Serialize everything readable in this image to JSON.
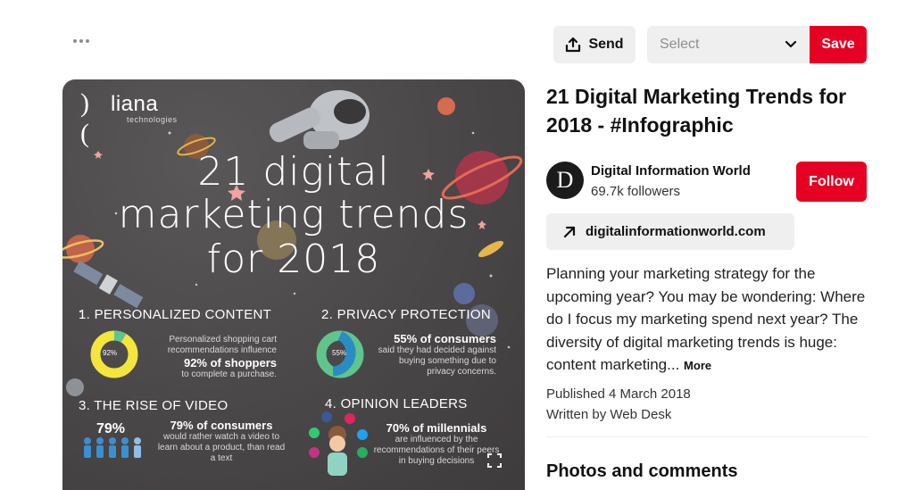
{
  "toolbar": {
    "send_label": "Send",
    "select_value": "Select",
    "save_label": "Save"
  },
  "pin": {
    "title": "21 Digital Marketing Trends for 2018 - #Infographic",
    "author": {
      "name": "Digital Information World",
      "followers": "69.7k followers",
      "avatar_letter": "D"
    },
    "follow_label": "Follow",
    "link_label": "digitalinformationworld.com",
    "description": "Planning your marketing strategy for the upcoming year? You may be wondering: Where do I focus my marketing spend next year? The diversity of digital marketing trends is huge: content marketing...",
    "more_label": "More",
    "published": "Published 4 March 2018",
    "written_by": "Written by Web Desk",
    "photos_title": "Photos and comments"
  },
  "infographic": {
    "brand_mark": ")(",
    "brand_name": "liana",
    "brand_sub": "technologies",
    "headline": [
      "21 digital",
      "marketing trends",
      "for 2018"
    ],
    "sections": [
      {
        "title": "1. PERSONALIZED CONTENT",
        "donut_label": "92%",
        "text_pre": "Personalized shopping cart recommendations influence",
        "text_big": "92% of shoppers",
        "text_post": "to complete a purchase."
      },
      {
        "title": "2. PRIVACY PROTECTION",
        "donut_label": "55%",
        "text_big": "55% of consumers",
        "text_post": "said they had decided against buying something due to privacy concerns."
      },
      {
        "title": "3. THE RISE OF VIDEO",
        "pct_label": "79%",
        "text_big": "79% of consumers",
        "text_post": "would rather watch a video to learn about a product, than read a text"
      },
      {
        "title": "4. OPINION LEADERS",
        "text_big": "70% of millennials",
        "text_post": "are influenced by the recommendations of their peers in buying decisions"
      }
    ]
  },
  "colors": {
    "brand_red": "#e60023",
    "button_gray": "#efefef",
    "donut_yellow": "#f3e53c",
    "donut_green": "#5fc58d",
    "donut_blue": "#2b8cc4",
    "video_blue": "#3a8fd0"
  },
  "icons": {
    "more": "more-dots-icon",
    "send": "share-upload-icon",
    "chevron": "chevron-down-icon",
    "link": "arrow-up-right-icon"
  }
}
